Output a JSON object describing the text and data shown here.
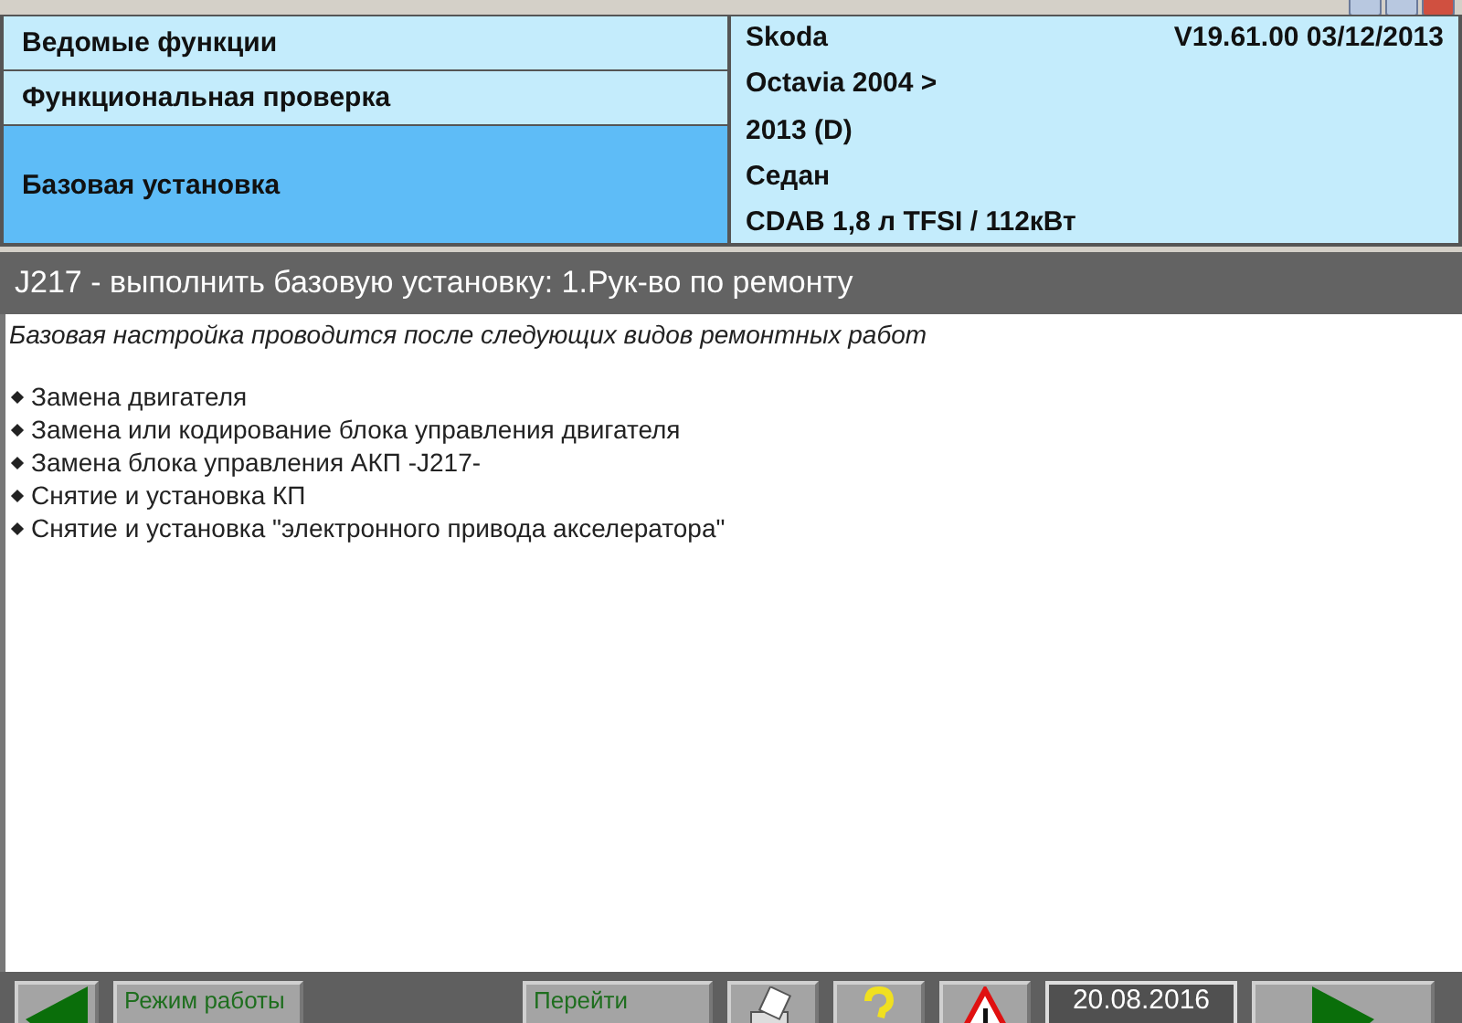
{
  "menu": [
    {
      "label": "Ведомые функции",
      "selected": false
    },
    {
      "label": "Функциональная проверка",
      "selected": false
    },
    {
      "label": "Базовая установка",
      "selected": true
    }
  ],
  "vehicle": {
    "make": "Skoda",
    "version": "V19.61.00 03/12/2013",
    "lines": [
      "Octavia 2004 >",
      "2013 (D)",
      "Седан",
      "CDAB 1,8 л TFSI / 112кВт"
    ]
  },
  "header": "J217 - выполнить базовую установку: 1.Рук-во по ремонту",
  "content": {
    "intro": "Базовая настройка проводится после следующих видов ремонтных работ",
    "items": [
      "Замена двигателя",
      "Замена или кодирование блока управления двигателя",
      "Замена блока управления АКП -J217-",
      "Снятие и установка КП",
      "Снятие и установка  \"электронного привода акселератора\""
    ]
  },
  "toolbar": {
    "mode_button": "Режим работы",
    "goto_button": "Перейти",
    "date": "20.08.2016"
  }
}
